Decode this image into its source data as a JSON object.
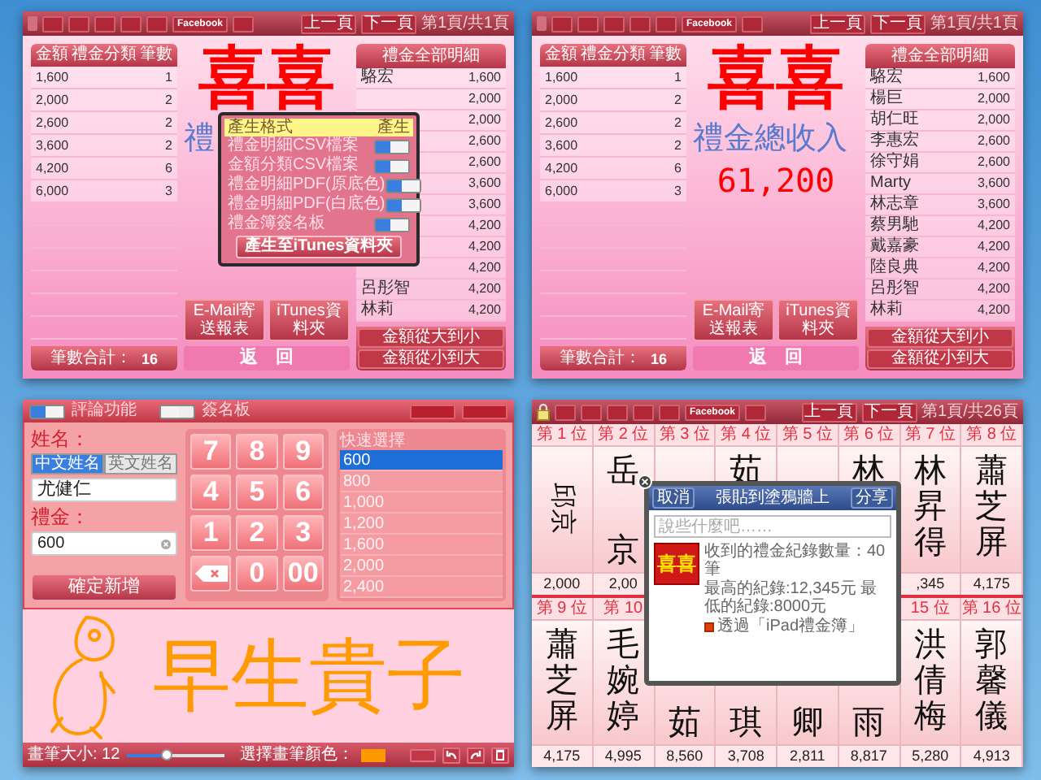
{
  "screens": [
    {
      "kind": "report",
      "toolbar": {
        "lock": false,
        "buttons": [
          {
            "kind": "blank"
          },
          {
            "kind": "blank"
          },
          {
            "kind": "blank"
          },
          {
            "kind": "blank"
          },
          {
            "kind": "blank"
          },
          {
            "kind": "text",
            "label": "Facebook"
          },
          {
            "kind": "blank"
          }
        ],
        "prev": "上一頁",
        "next": "下一頁",
        "page": "第1頁/共1頁"
      },
      "categories": {
        "columns": [
          "金額",
          "禮金分類",
          "筆數"
        ],
        "rows": [
          {
            "amount": "1,600",
            "count": "1"
          },
          {
            "amount": "2,000",
            "count": "2"
          },
          {
            "amount": "2,600",
            "count": "2"
          },
          {
            "amount": "3,600",
            "count": "2"
          },
          {
            "amount": "4,200",
            "count": "6"
          },
          {
            "amount": "6,000",
            "count": "3"
          }
        ],
        "total_label": "筆數合計：",
        "total": "16"
      },
      "summary": {
        "logo": "喜喜",
        "title": "禮",
        "buttons": [
          "E-Mail寄送報表",
          "iTunes資料夾"
        ],
        "back": "返　回"
      },
      "details": {
        "title": "禮金全部明細",
        "rows": [
          {
            "name": "駱宏",
            "amount": "1,600"
          },
          {
            "amount": "2,000"
          },
          {
            "amount": "2,000"
          },
          {
            "amount": "2,600"
          },
          {
            "amount": "2,600"
          },
          {
            "amount": "3,600"
          },
          {
            "amount": "3,600"
          },
          {
            "amount": "4,200"
          },
          {
            "amount": "4,200"
          },
          {
            "amount": "4,200"
          },
          {
            "name": "呂彤智",
            "amount": "4,200"
          },
          {
            "name": "林莉",
            "amount": "4,200"
          }
        ],
        "sort_buttons": [
          "金額從大到小",
          "金額從小到大"
        ]
      },
      "export_popup": {
        "header": [
          "產生格式",
          "產生"
        ],
        "options": [
          {
            "label": "禮金明細CSV檔案",
            "on": true
          },
          {
            "label": "金額分類CSV檔案",
            "on": true
          },
          {
            "label": "禮金明細PDF(原底色)",
            "on": true
          },
          {
            "label": "禮金明細PDF(白底色)",
            "on": true
          },
          {
            "label": "禮金簿簽名板",
            "on": true
          }
        ],
        "button": "產生至iTunes資料夾"
      }
    },
    {
      "kind": "report",
      "toolbar": {
        "lock": false,
        "buttons": [
          {
            "kind": "blank"
          },
          {
            "kind": "blank"
          },
          {
            "kind": "blank"
          },
          {
            "kind": "blank"
          },
          {
            "kind": "blank"
          },
          {
            "kind": "text",
            "label": "Facebook"
          },
          {
            "kind": "blank"
          }
        ],
        "prev": "上一頁",
        "next": "下一頁",
        "page": "第1頁/共1頁"
      },
      "categories": {
        "columns": [
          "金額",
          "禮金分類",
          "筆數"
        ],
        "rows": [
          {
            "amount": "1,600",
            "count": "1"
          },
          {
            "amount": "2,000",
            "count": "2"
          },
          {
            "amount": "2,600",
            "count": "2"
          },
          {
            "amount": "3,600",
            "count": "2"
          },
          {
            "amount": "4,200",
            "count": "6"
          },
          {
            "amount": "6,000",
            "count": "3"
          }
        ],
        "total_label": "筆數合計：",
        "total": "16"
      },
      "summary": {
        "logo": "喜喜",
        "title": "禮金總收入",
        "total": "61,200",
        "buttons": [
          "E-Mail寄送報表",
          "iTunes資料夾"
        ],
        "back": "返　回"
      },
      "details": {
        "title": "禮金全部明細",
        "rows": [
          {
            "name": "駱宏",
            "amount": "1,600"
          },
          {
            "name": "楊巨",
            "amount": "2,000"
          },
          {
            "name": "胡仁旺",
            "amount": "2,000"
          },
          {
            "name": "李惠宏",
            "amount": "2,600"
          },
          {
            "name": "徐守娟",
            "amount": "2,600"
          },
          {
            "name": "Marty",
            "amount": "3,600"
          },
          {
            "name": "林志章",
            "amount": "3,600"
          },
          {
            "name": "蔡男馳",
            "amount": "4,200"
          },
          {
            "name": "戴嘉豪",
            "amount": "4,200"
          },
          {
            "name": "陸良典",
            "amount": "4,200"
          },
          {
            "name": "呂彤智",
            "amount": "4,200"
          },
          {
            "name": "林莉",
            "amount": "4,200"
          }
        ],
        "sort_buttons": [
          "金額從大到小",
          "金額從小到大"
        ]
      }
    },
    {
      "kind": "entry",
      "top_bar": {
        "toggles": [
          {
            "label": "評論功能",
            "on": true
          },
          {
            "label": "簽名板",
            "on": false
          }
        ],
        "buttons": [
          {
            "kind": "blank"
          },
          {
            "kind": "blank"
          }
        ]
      },
      "form": {
        "name_label": "姓名：",
        "name_modes": [
          {
            "label": "中文姓名",
            "selected": true
          },
          {
            "label": "英文姓名",
            "selected": false
          }
        ],
        "name_value": "尤健仁",
        "amount_label": "禮金：",
        "amount_value": "600",
        "submit": "確定新增"
      },
      "keypad": [
        {
          "kind": "digit",
          "label": "7"
        },
        {
          "kind": "digit",
          "label": "8"
        },
        {
          "kind": "digit",
          "label": "9"
        },
        {
          "kind": "digit",
          "label": "4"
        },
        {
          "kind": "digit",
          "label": "5"
        },
        {
          "kind": "digit",
          "label": "6"
        },
        {
          "kind": "digit",
          "label": "1"
        },
        {
          "kind": "digit",
          "label": "2"
        },
        {
          "kind": "digit",
          "label": "3"
        },
        {
          "kind": "backspace"
        },
        {
          "kind": "digit",
          "label": "0"
        },
        {
          "kind": "digit",
          "label": "00"
        }
      ],
      "quick_select": {
        "title": "快速選擇",
        "items": [
          {
            "label": "600",
            "selected": true
          },
          {
            "label": "800",
            "selected": false
          },
          {
            "label": "1,000",
            "selected": false
          },
          {
            "label": "1,200",
            "selected": false
          },
          {
            "label": "1,600",
            "selected": false
          },
          {
            "label": "2,000",
            "selected": false
          },
          {
            "label": "2,400",
            "selected": false
          }
        ]
      },
      "signature": {
        "text": "早生貴子"
      },
      "bottom_bar": {
        "brush_label": "畫筆大小: 12",
        "level": 0.4,
        "color_label": "選擇畫筆顏色：",
        "color": "#ff9900"
      }
    },
    {
      "kind": "ranking",
      "toolbar": {
        "lock": true,
        "buttons": [
          {
            "kind": "blank"
          },
          {
            "kind": "blank"
          },
          {
            "kind": "blank"
          },
          {
            "kind": "blank"
          },
          {
            "kind": "blank"
          },
          {
            "kind": "text",
            "label": "Facebook"
          },
          {
            "kind": "blank"
          }
        ],
        "prev": "上一頁",
        "next": "下一頁",
        "page": "第1頁/共26頁"
      },
      "rows": [
        [
          {
            "rank": "第 1 位",
            "name_sideways": "邱京",
            "amount": "2,000"
          },
          {
            "rank": "第 2 位",
            "name_top": "岳",
            "name_bottom": "京",
            "amount": "2,00"
          },
          {
            "rank": "第 3 位"
          },
          {
            "rank": "第 4 位",
            "name_top": "茹"
          },
          {
            "rank": "第 5 位"
          },
          {
            "rank": "第 6 位",
            "name_top": "林"
          },
          {
            "rank": "第 7 位",
            "name_top": "林昇得",
            "amount": ",345"
          },
          {
            "rank": "第 8 位",
            "name_top": "蕭芝屏",
            "amount": "4,175"
          }
        ],
        [
          {
            "rank": "第 9 位",
            "name_top": "蕭芝屏",
            "amount": "4,175"
          },
          {
            "rank": "第 10",
            "name_top": "毛婉婷",
            "amount": "4,995"
          },
          {
            "name_bottom": "茹",
            "amount": "8,560"
          },
          {
            "name_bottom": "琪",
            "amount": "3,708"
          },
          {
            "name_bottom": "卿",
            "amount": "2,811"
          },
          {
            "name_bottom": "雨",
            "amount": "8,817"
          },
          {
            "rank": "15 位",
            "name_top": "洪倩梅",
            "amount": "5,280"
          },
          {
            "rank": "第 16 位",
            "name_top": "郭馨儀",
            "amount": "4,913"
          }
        ]
      ],
      "share_popup": {
        "cancel": "取消",
        "title": "張貼到塗鴉牆上",
        "share": "分享",
        "placeholder": "說些什麼吧……",
        "logo": "喜喜",
        "lines": [
          "收到的禮金紀錄數量：40筆",
          "最高的紀錄:12,345元 最低的紀錄:8000元"
        ],
        "via": "透過「iPad禮金簿」"
      }
    }
  ]
}
